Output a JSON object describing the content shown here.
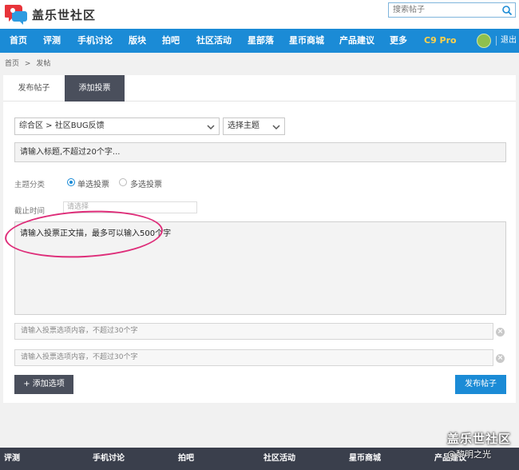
{
  "header": {
    "brand_name": "盖乐世社区",
    "search_placeholder": "搜索帖子"
  },
  "nav": {
    "items": [
      "首页",
      "评测",
      "手机讨论",
      "版块",
      "拍吧",
      "社区活动",
      "星部落",
      "星币商城",
      "产品建议",
      "更多",
      "C9 Pro"
    ],
    "logout": "退出"
  },
  "breadcrumb": [
    "首页",
    ">",
    "发帖"
  ],
  "tabs": [
    "发布帖子",
    "添加投票"
  ],
  "form": {
    "forum_select": "综合区 > 社区BUG反馈",
    "topic_select": "选择主题",
    "title_placeholder": "请输入标题,不超过20个字...",
    "topic_category_label": "主题分类",
    "single_vote_label": "单选投票",
    "multi_vote_label": "多选投票",
    "deadline_label": "截止时间",
    "deadline_placeholder": "请选择",
    "body_placeholder": "请输入投票正文描，最多可以输入500个字",
    "options": [
      "请输入投票选项内容，不超过30个字",
      "请输入投票选项内容，不超过30个字"
    ],
    "add_option_label": "+ 添加选项",
    "submit_label": "发布帖子"
  },
  "footer": {
    "items": [
      "评测",
      "手机讨论",
      "拍吧",
      "社区活动",
      "星币商城",
      "产品建议"
    ]
  },
  "watermark": {
    "line1": "盖乐世社区",
    "line2": "@黎明之光"
  },
  "colors": {
    "nav_blue": "#1b8bd6",
    "dark_tab": "#4a4f5c",
    "highlight_circle": "#de2d79",
    "c9_pro": "#ffd24a"
  }
}
